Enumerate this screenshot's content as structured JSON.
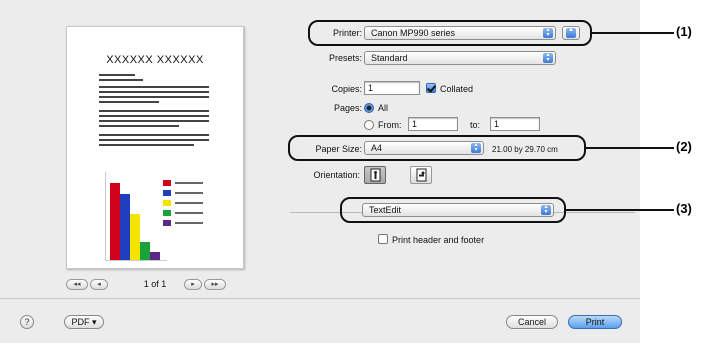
{
  "preview": {
    "doc_title": "XXXXXX XXXXXX",
    "page_indicator": "1 of 1",
    "first_page_label": "◂◂",
    "prev_page_label": "◂",
    "next_page_label": "▸",
    "last_page_label": "▸▸",
    "mini_chart_colors": [
      "#d0021b",
      "#1f3fbf",
      "#f4e400",
      "#19a33a",
      "#5b2a86"
    ],
    "mini_chart_levels": [
      0.92,
      0.78,
      0.55,
      0.22,
      0.09
    ]
  },
  "form": {
    "printer_label": "Printer:",
    "printer_value": "Canon MP990 series",
    "presets_label": "Presets:",
    "presets_value": "Standard",
    "copies_label": "Copies:",
    "copies_value": "1",
    "collated_label": "Collated",
    "collated_checked": true,
    "pages_label": "Pages:",
    "pages_all_label": "All",
    "pages_from_label": "From:",
    "pages_from_value": "1",
    "pages_to_label": "to:",
    "pages_to_value": "1",
    "paper_size_label": "Paper Size:",
    "paper_size_value": "A4",
    "paper_dimensions": "21.00 by 29.70 cm",
    "orientation_label": "Orientation:",
    "app_pane_value": "TextEdit",
    "header_footer_label": "Print header and footer",
    "header_footer_checked": false
  },
  "callouts": [
    "(1)",
    "(2)",
    "(3)"
  ],
  "bottom_bar": {
    "help_label": "?",
    "pdf_label": "PDF ▾",
    "cancel_label": "Cancel",
    "print_label": "Print"
  }
}
